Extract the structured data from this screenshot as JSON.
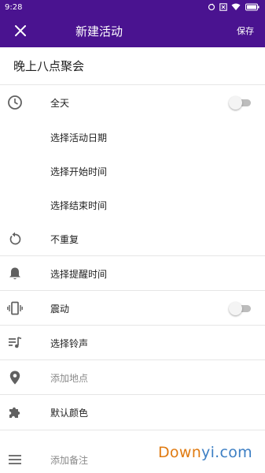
{
  "status_bar": {
    "time": "9:28"
  },
  "app_bar": {
    "title": "新建活动",
    "save_label": "保存"
  },
  "event": {
    "title": "晚上八点聚会"
  },
  "rows": {
    "all_day": {
      "label": "全天",
      "toggle_on": false
    },
    "date": {
      "label": "选择活动日期"
    },
    "start_time": {
      "label": "选择开始时间"
    },
    "end_time": {
      "label": "选择结束时间"
    },
    "repeat": {
      "label": "不重复"
    },
    "reminder": {
      "label": "选择提醒时间"
    },
    "vibrate": {
      "label": "震动",
      "toggle_on": false
    },
    "ringtone": {
      "label": "选择铃声"
    },
    "location": {
      "placeholder": "添加地点"
    },
    "color": {
      "label": "默认颜色"
    },
    "notes": {
      "placeholder": "添加备注"
    }
  },
  "watermark": {
    "part1": "Down",
    "part2": "yi.com"
  },
  "colors": {
    "app_bar": "#4a1390",
    "icon": "#616161",
    "divider": "#e6e6e6",
    "hint": "#8a8a8a"
  }
}
